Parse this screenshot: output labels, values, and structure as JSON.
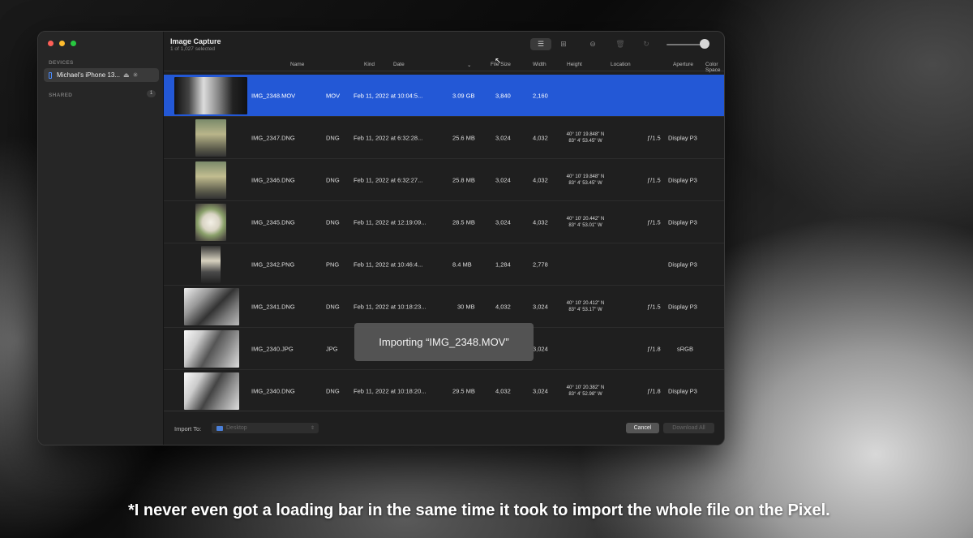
{
  "window": {
    "title": "Image Capture",
    "subtitle": "1 of 1,027 selected"
  },
  "sidebar": {
    "devices_heading": "DEVICES",
    "device_name": "Michael's iPhone 13...",
    "shared_heading": "SHARED",
    "shared_count": "1"
  },
  "toolbar": {
    "list_view_icon": "list-icon",
    "grid_view_icon": "grid-icon",
    "delete_icon": "minus-circle-icon",
    "trash_icon": "trash-icon",
    "rotate_icon": "rotate-icon",
    "thumbnail_size_slider": "zoom-slider"
  },
  "columns": {
    "name": "Name",
    "kind": "Kind",
    "date": "Date",
    "file_size": "File Size",
    "width": "Width",
    "height": "Height",
    "location": "Location",
    "aperture": "Aperture",
    "color_space": "Color Space",
    "extra": "S"
  },
  "rows": [
    {
      "name": "IMG_2348.MOV",
      "kind": "MOV",
      "date": "Feb 11, 2022 at 10:04:5...",
      "size": "3.09 GB",
      "width": "3,840",
      "height": "2,160",
      "loc1": "",
      "loc2": "",
      "aperture": "",
      "color": "",
      "selected": true
    },
    {
      "name": "IMG_2347.DNG",
      "kind": "DNG",
      "date": "Feb 11, 2022 at 6:32:28...",
      "size": "25.6 MB",
      "width": "3,024",
      "height": "4,032",
      "loc1": "40° 10' 19.848\" N",
      "loc2": "83° 4' 53.45\" W",
      "aperture": "ƒ/1.5",
      "color": "Display P3"
    },
    {
      "name": "IMG_2346.DNG",
      "kind": "DNG",
      "date": "Feb 11, 2022 at 6:32:27...",
      "size": "25.8 MB",
      "width": "3,024",
      "height": "4,032",
      "loc1": "40° 10' 19.848\" N",
      "loc2": "83° 4' 53.45\" W",
      "aperture": "ƒ/1.5",
      "color": "Display P3"
    },
    {
      "name": "IMG_2345.DNG",
      "kind": "DNG",
      "date": "Feb 11, 2022 at 12:19:09...",
      "size": "28.5 MB",
      "width": "3,024",
      "height": "4,032",
      "loc1": "40° 10' 20.442\" N",
      "loc2": "83° 4' 53.01\" W",
      "aperture": "ƒ/1.5",
      "color": "Display P3"
    },
    {
      "name": "IMG_2342.PNG",
      "kind": "PNG",
      "date": "Feb 11, 2022 at 10:46:4...",
      "size": "8.4 MB",
      "width": "1,284",
      "height": "2,778",
      "loc1": "",
      "loc2": "",
      "aperture": "",
      "color": "Display P3"
    },
    {
      "name": "IMG_2341.DNG",
      "kind": "DNG",
      "date": "Feb 11, 2022 at 10:18:23...",
      "size": "30 MB",
      "width": "4,032",
      "height": "3,024",
      "loc1": "40° 10' 20.412\" N",
      "loc2": "83° 4' 53.17\" W",
      "aperture": "ƒ/1.5",
      "color": "Display P3"
    },
    {
      "name": "IMG_2340.JPG",
      "kind": "JPG",
      "date": "",
      "size": "",
      "width": "",
      "height": "3,024",
      "loc1": "",
      "loc2": "",
      "aperture": "ƒ/1.8",
      "color": "sRGB"
    },
    {
      "name": "IMG_2340.DNG",
      "kind": "DNG",
      "date": "Feb 11, 2022 at 10:18:20...",
      "size": "29.5 MB",
      "width": "4,032",
      "height": "3,024",
      "loc1": "40° 10' 20.382\" N",
      "loc2": "83° 4' 52.98\" W",
      "aperture": "ƒ/1.8",
      "color": "Display P3"
    }
  ],
  "bottombar": {
    "import_label": "Import To:",
    "import_destination": "Desktop",
    "cancel_label": "Cancel",
    "download_label": "Download All"
  },
  "toast": {
    "text": "Importing “IMG_2348.MOV”"
  },
  "caption": "*I never even got a loading bar in the same time it took to import the whole file on the Pixel.",
  "colors": {
    "selection": "#2358d6",
    "window_bg": "#1f1f1f",
    "sidebar_bg": "#262626"
  }
}
